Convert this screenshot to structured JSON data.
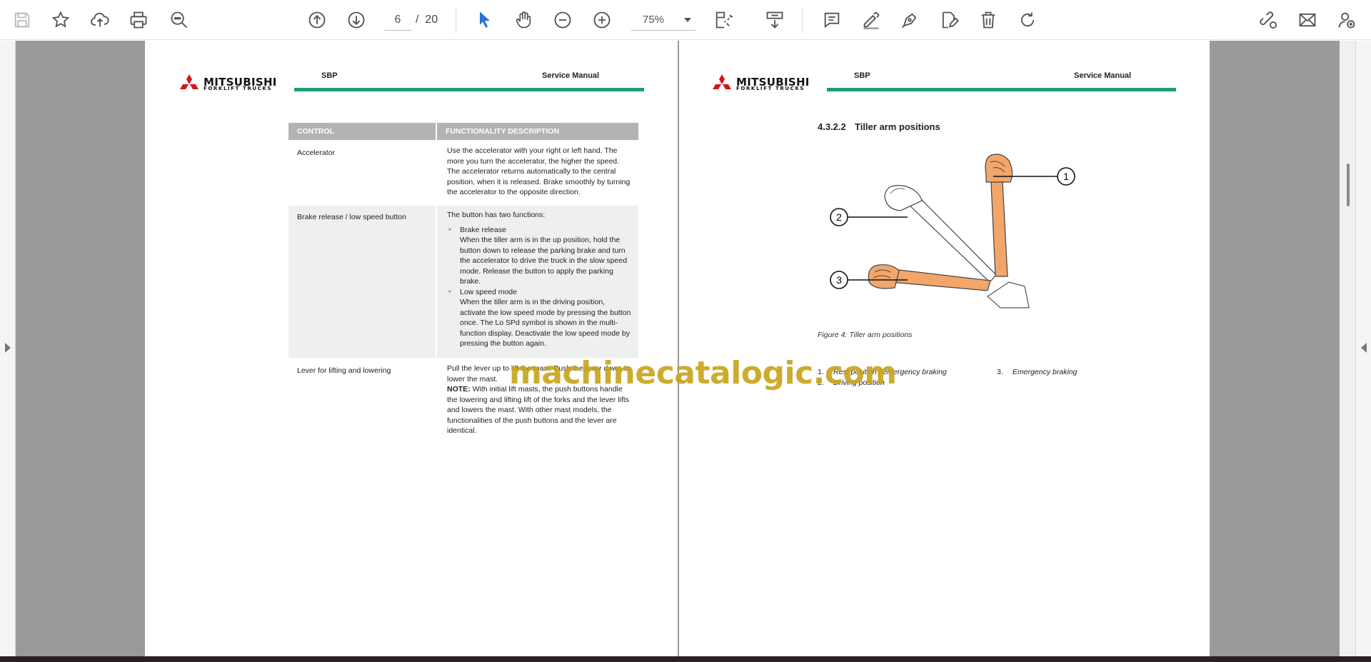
{
  "toolbar": {
    "page_current": "6",
    "page_sep": "/",
    "page_total": "20",
    "zoom": "75%",
    "icons": [
      "save-icon",
      "bookmark-star-icon",
      "upload-cloud-icon",
      "print-icon",
      "zoom-search-icon",
      "page-up-icon",
      "page-down-icon",
      "select-cursor-icon",
      "hand-pan-icon",
      "zoom-out-icon",
      "zoom-in-icon",
      "page-fit-icon",
      "scroll-mode-icon",
      "comment-icon",
      "highlight-pen-icon",
      "draw-pen-icon",
      "edit-icon",
      "delete-trash-icon",
      "rotate-icon",
      "share-link-icon",
      "email-icon",
      "add-user-icon"
    ],
    "accent_color": "#2d6fd2"
  },
  "left_page": {
    "logo": {
      "name": "MITSUBISHI",
      "sub": "FORKLIFT TRUCKS"
    },
    "header_left": "SBP",
    "header_right": "Service Manual",
    "table": {
      "headers": [
        "CONTROL",
        "FUNCTIONALITY DESCRIPTION"
      ],
      "rows": [
        {
          "control": "Accelerator",
          "description": "Use the accelerator with your right or left hand. The more you turn the accelerator, the higher the speed. The accelerator returns automatically to the central position, when it is released. Brake smoothly by turning the accelerator to the opposite direction."
        },
        {
          "control": "Brake release / low speed button",
          "intro": "The button has two functions:",
          "bullet1_title": "Brake release",
          "bullet1_text": "When the tiller arm is in the up position, hold the button down to release the parking brake and turn the accelerator to drive the truck in the slow speed mode. Release the button to apply the parking brake.",
          "bullet2_title": "Low speed mode",
          "bullet2_text": "When the tiller arm is in the driving position, activate the low speed mode by pressing the button once. The Lo SPd symbol is shown in the multi-function display. Deactivate the low speed mode by pressing the button again."
        },
        {
          "control": "Lever for lifting and lowering",
          "text1": "Pull the lever up to lift the mast. Push the lever down to lower the mast.",
          "note_label": "NOTE:",
          "note_text": "With initial lift masts, the push buttons handle the lowering and lifting lift of the forks and the lever lifts and lowers the mast. With other mast models, the functionalities of the push buttons and the lever are identical."
        }
      ]
    }
  },
  "right_page": {
    "logo": {
      "name": "MITSUBISHI",
      "sub": "FORKLIFT TRUCKS"
    },
    "header_left": "SBP",
    "header_right": "Service Manual",
    "section_number": "4.3.2.2",
    "section_title": "Tiller arm positions",
    "figure_callouts": [
      "1",
      "2",
      "3"
    ],
    "figure_caption": "Figure 4: Tiller arm positions",
    "legend": [
      {
        "n": "1.",
        "text": "Rest position / emergency braking"
      },
      {
        "n": "2.",
        "text": "Driving position"
      },
      {
        "n": "3.",
        "text": "Emergency braking"
      }
    ]
  },
  "watermark": "machinecatalogic.com",
  "colors": {
    "header_line": "#1e9a7c",
    "logo_red": "#d7141a",
    "tiller_orange": "#f2a66a",
    "table_header": "#b3b3b3"
  }
}
